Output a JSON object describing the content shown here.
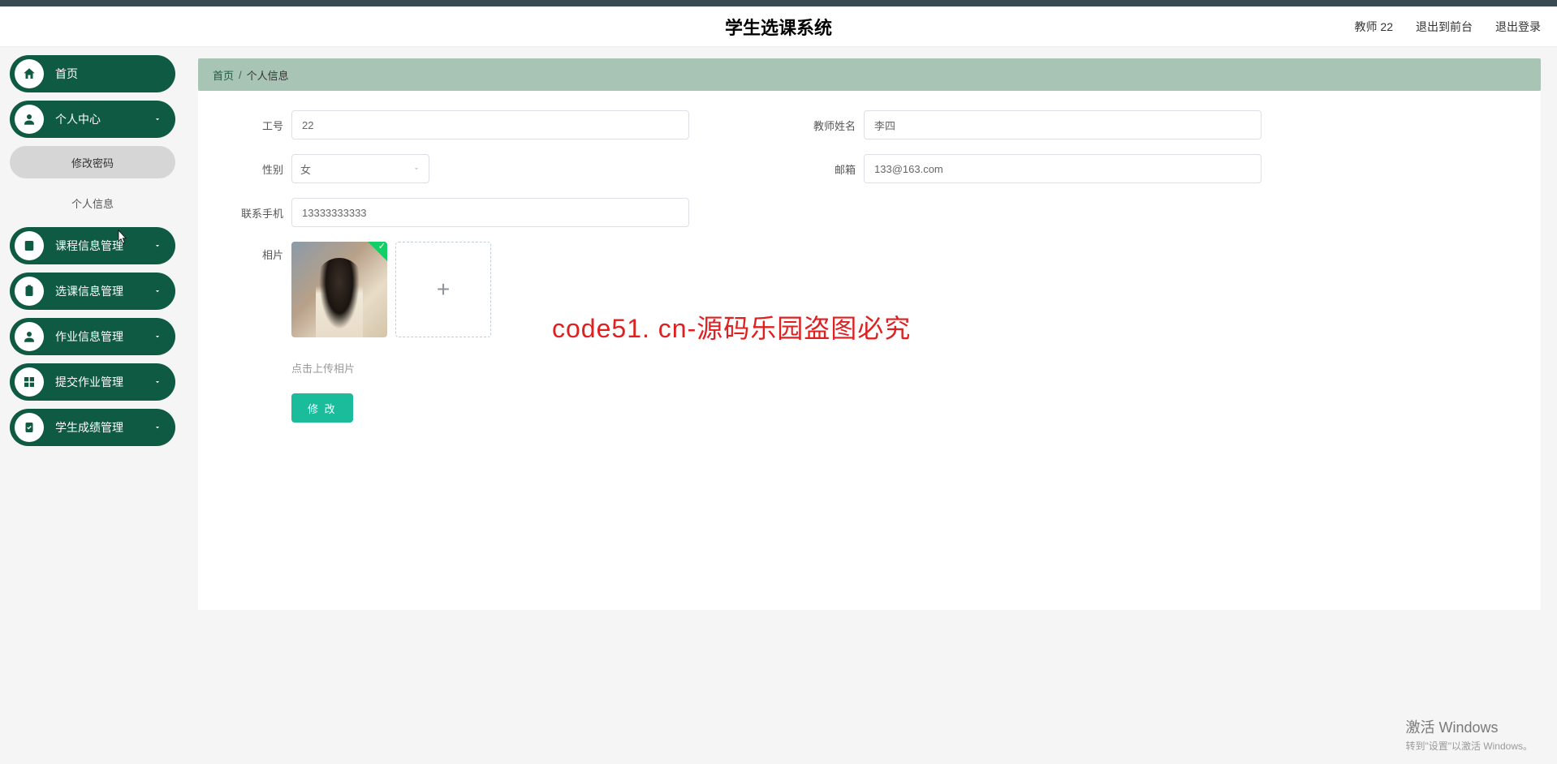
{
  "header": {
    "title": "学生选课系统",
    "user_label": "教师 22",
    "exit_front": "退出到前台",
    "logout": "退出登录"
  },
  "sidebar": {
    "items": [
      {
        "label": "首页",
        "icon": "home",
        "expandable": false
      },
      {
        "label": "个人中心",
        "icon": "user",
        "expandable": true
      },
      {
        "label": "课程信息管理",
        "icon": "book",
        "expandable": true
      },
      {
        "label": "选课信息管理",
        "icon": "clipboard",
        "expandable": true
      },
      {
        "label": "作业信息管理",
        "icon": "user",
        "expandable": true
      },
      {
        "label": "提交作业管理",
        "icon": "grid",
        "expandable": true
      },
      {
        "label": "学生成绩管理",
        "icon": "clipboard-check",
        "expandable": true
      }
    ],
    "submenu": [
      {
        "label": "修改密码",
        "active": true
      },
      {
        "label": "个人信息",
        "active": false
      }
    ]
  },
  "breadcrumb": {
    "home": "首页",
    "sep": "/",
    "current": "个人信息"
  },
  "form": {
    "id_label": "工号",
    "id_value": "22",
    "name_label": "教师姓名",
    "name_value": "李四",
    "gender_label": "性别",
    "gender_value": "女",
    "email_label": "邮箱",
    "email_value": "133@163.com",
    "phone_label": "联系手机",
    "phone_value": "13333333333",
    "photo_label": "相片",
    "upload_hint": "点击上传相片",
    "submit": "修 改"
  },
  "watermark": "code51. cn-源码乐园盗图必究",
  "activate": {
    "title": "激活 Windows",
    "sub": "转到\"设置\"以激活 Windows。"
  }
}
